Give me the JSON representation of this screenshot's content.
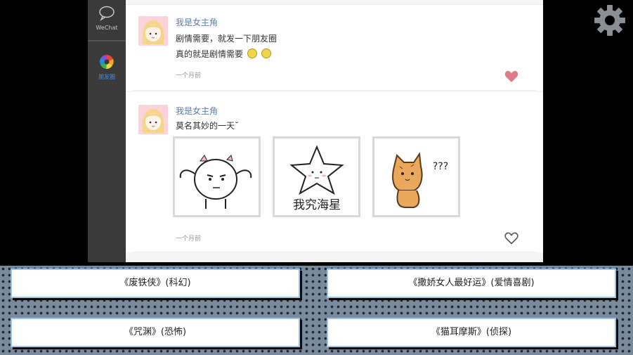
{
  "sidebar": {
    "wechat_label": "WeChat",
    "moments_label": "朋友圈"
  },
  "posts": [
    {
      "name": "我是女主角",
      "lines": [
        "剧情需要，就发一下朋友圈",
        "真的就是剧情需要"
      ],
      "time": "一个月前",
      "liked": true
    },
    {
      "name": "我是女主角",
      "lines": [
        "莫名其妙的一天˘"
      ],
      "photos": [
        "girl-with-pigtails-sticker",
        "star-sticker",
        "confused-cat-sticker"
      ],
      "photo_captions": [
        "",
        "我究海星",
        "???"
      ],
      "time": "一个月前",
      "liked": false
    }
  ],
  "colors": {
    "name": "#5a7bb0",
    "liked_heart": "#e07b8a",
    "choice_border": "#9fc3e8"
  },
  "choices": [
    "《废铁侠》(科幻)",
    "《撒娇女人最好运》(爱情喜剧)",
    "《咒渊》(恐怖)",
    "《猫耳摩斯》(侦探)"
  ]
}
